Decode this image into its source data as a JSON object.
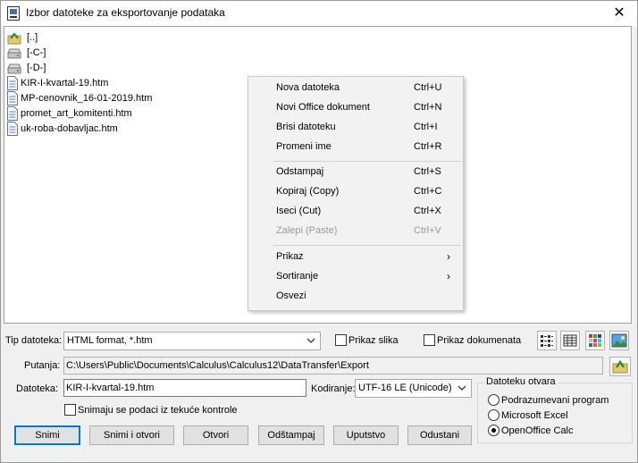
{
  "window": {
    "title": "Izbor datoteke za eksportovanje podataka",
    "close_glyph": "✕"
  },
  "files": [
    {
      "name": "[..]",
      "icon": "folder-up-icon"
    },
    {
      "name": "[-C-]",
      "icon": "drive-icon"
    },
    {
      "name": "[-D-]",
      "icon": "drive-icon"
    },
    {
      "name": "KIR-I-kvartal-19.htm",
      "icon": "document-icon"
    },
    {
      "name": "MP-cenovnik_16-01-2019.htm",
      "icon": "document-icon"
    },
    {
      "name": "promet_art_komitenti.htm",
      "icon": "document-icon"
    },
    {
      "name": "uk-roba-dobavljac.htm",
      "icon": "document-icon"
    }
  ],
  "context_menu": {
    "items": [
      {
        "label": "Nova datoteka",
        "shortcut": "Ctrl+U"
      },
      {
        "label": "Novi Office dokument",
        "shortcut": "Ctrl+N"
      },
      {
        "label": "Brisi datoteku",
        "shortcut": "Ctrl+I"
      },
      {
        "label": "Promeni ime",
        "shortcut": "Ctrl+R"
      },
      {
        "label": "Odstampaj",
        "shortcut": "Ctrl+S"
      },
      {
        "label": "Kopiraj (Copy)",
        "shortcut": "Ctrl+C"
      },
      {
        "label": "Iseci (Cut)",
        "shortcut": "Ctrl+X"
      },
      {
        "label": "Zalepi (Paste)",
        "shortcut": "Ctrl+V",
        "disabled": true
      },
      {
        "label": "Prikaz",
        "arrow": "›"
      },
      {
        "label": "Sortiranje",
        "arrow": "›"
      },
      {
        "label": "Osvezi"
      }
    ]
  },
  "file_type": {
    "label": "Tip datoteka:",
    "value": "HTML format, *.htm"
  },
  "show_images": {
    "label": "Prikaz slika",
    "checked": false
  },
  "show_documents": {
    "label": "Prikaz dokumenata",
    "checked": false
  },
  "path": {
    "label": "Putanja:",
    "value": "C:\\Users\\Public\\Documents\\Calculus\\Calculus12\\DataTransfer\\Export"
  },
  "filename": {
    "label": "Datoteka:",
    "value": "KIR-I-kvartal-19.htm"
  },
  "encoding": {
    "label": "Kodiranje:",
    "value": "UTF-16 LE (Unicode)"
  },
  "snapshot": {
    "label": "Snimaju se podaci iz tekuće kontrole",
    "checked": false
  },
  "open_with": {
    "title": "Datoteku otvara",
    "options": [
      {
        "label": "Podrazumevani program",
        "selected": false
      },
      {
        "label": "Microsoft Excel",
        "selected": false
      },
      {
        "label": "OpenOffice Calc",
        "selected": true
      }
    ]
  },
  "buttons": {
    "save": "Snimi",
    "save_open": "Snimi i otvori",
    "open": "Otvori",
    "print": "Odštampaj",
    "help": "Uputstvo",
    "cancel": "Odustani"
  },
  "colors": {
    "accent": "#0078d7",
    "disabled_text": "#9a9a9a"
  }
}
